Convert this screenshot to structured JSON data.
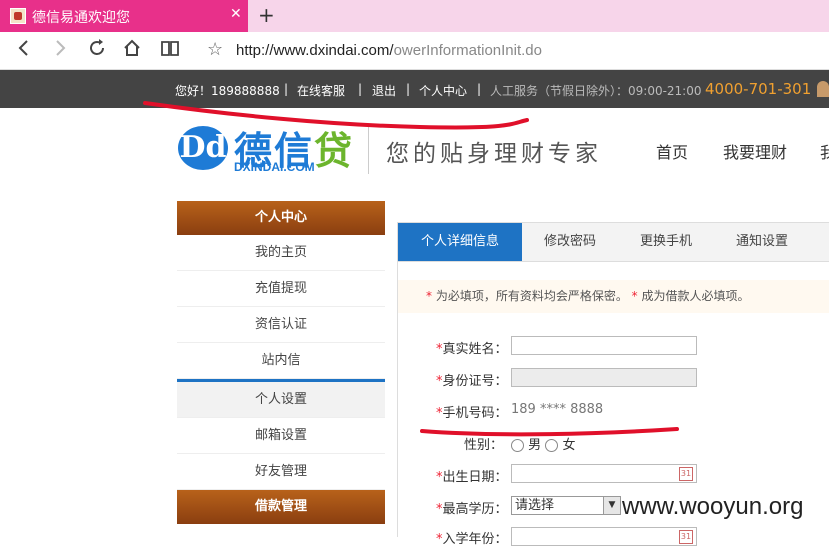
{
  "browser": {
    "tab_title": "德信易通欢迎您",
    "close_glyph": "✕",
    "newtab_glyph": "+",
    "url_host": "http://www.dxindai.com/",
    "url_path": "owerInformationInit.do",
    "icons": [
      "back-icon",
      "forward-icon",
      "refresh-icon",
      "home-icon",
      "reading-view-icon",
      "favorite-star-icon"
    ]
  },
  "topbar": {
    "greeting": "您好！189888888",
    "service": "在线客服",
    "logout": "退出",
    "personal": "个人中心",
    "hours": "人工服务（节假日除外）：09:00-21:00",
    "phone": "4000-701-301",
    "sep": "|"
  },
  "header": {
    "logo_mark": "Dd",
    "logo_cn_a": "德信",
    "logo_cn_b": "贷",
    "logo_en": "DXINDAI.COM",
    "slogan": "您的贴身理财专家",
    "nav": [
      "首页",
      "我要理财",
      "我"
    ]
  },
  "sidebar": {
    "personal_head": "个人中心",
    "items": [
      "我的主页",
      "充值提现",
      "资信认证",
      "站内信",
      "个人设置",
      "邮箱设置",
      "好友管理"
    ],
    "loan_head": "借款管理"
  },
  "content": {
    "tabs": [
      "个人详细信息",
      "修改密码",
      "更换手机",
      "通知设置"
    ],
    "notice_a": "为必填项，所有资料均会严格保密。",
    "notice_b": "成为借款人必填项。",
    "fields": {
      "name_label": "真实姓名：",
      "id_label": "身份证号：",
      "phone_label": "手机号码：",
      "phone_value": "189 **** 8888",
      "gender_label": "性别：",
      "gender_male": "男",
      "gender_female": "女",
      "birth_label": "出生日期：",
      "edu_label": "最高学历：",
      "edu_value": "请选择",
      "enroll_label": "入学年份："
    }
  },
  "watermark": "www.wooyun.org",
  "colors": {
    "accent": "#1e73c4",
    "tab_pink": "#e8308a",
    "annotation_red": "#e0102a",
    "phone_orange": "#f0a030"
  }
}
